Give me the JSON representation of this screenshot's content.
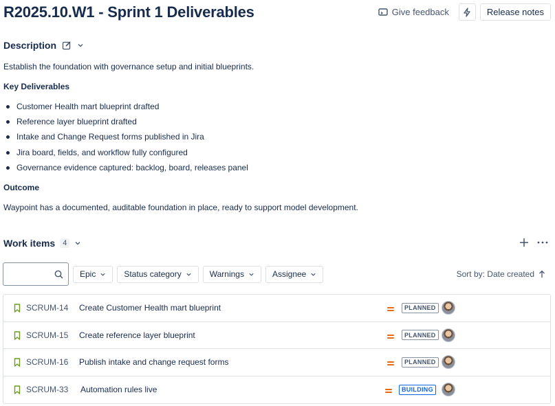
{
  "header": {
    "title": "R2025.10.W1 - Sprint 1 Deliverables",
    "feedback_label": "Give feedback",
    "release_notes_label": "Release notes"
  },
  "description": {
    "label": "Description",
    "intro": "Establish the foundation with governance setup and initial blueprints.",
    "deliverables_heading": "Key Deliverables",
    "deliverables": [
      "Customer Health mart blueprint drafted",
      "Reference layer blueprint drafted",
      "Intake and Change Request forms published in Jira",
      "Jira board, fields, and workflow fully configured",
      "Governance evidence captured: backlog, board, releases panel"
    ],
    "outcome_heading": "Outcome",
    "outcome": "Waypoint has a documented, auditable foundation in place, ready to support model development."
  },
  "work_items": {
    "label": "Work items",
    "count": "4",
    "search": {
      "placeholder": ""
    },
    "filters": [
      "Epic",
      "Status category",
      "Warnings",
      "Assignee"
    ],
    "sort_label": "Sort by: Date created",
    "rows": [
      {
        "key": "SCRUM-14",
        "summary": "Create Customer Health mart blueprint",
        "status": "PLANNED"
      },
      {
        "key": "SCRUM-15",
        "summary": "Create reference layer blueprint",
        "status": "PLANNED"
      },
      {
        "key": "SCRUM-16",
        "summary": "Publish intake and change request forms",
        "status": "PLANNED"
      },
      {
        "key": "SCRUM-33",
        "summary": "Automation rules live",
        "status": "BUILDING"
      }
    ]
  },
  "colors": {
    "accent_blue": "#0c66e4",
    "priority_medium": "#e56910",
    "bookmark_green": "#6a9a23"
  },
  "icons": {
    "feedback": "feedback-icon",
    "lightning": "lightning-icon",
    "edit": "edit-icon",
    "chevron": "chevron-down-icon",
    "search": "search-icon",
    "add": "plus-icon",
    "more": "more-icon",
    "sort": "arrow-up-icon",
    "bookmark": "bookmark-icon",
    "priority": "priority-medium-icon"
  }
}
